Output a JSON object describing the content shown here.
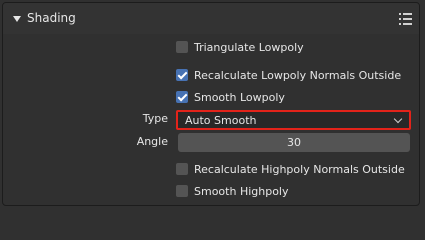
{
  "panel": {
    "title": "Shading",
    "collapse_icon": "triangle-down-icon",
    "options_icon": "list-icon"
  },
  "checkboxes": {
    "triangulate_lowpoly": {
      "label": "Triangulate Lowpoly",
      "checked": false
    },
    "recalc_lowpoly_normals": {
      "label": "Recalculate Lowpoly Normals Outside",
      "checked": true
    },
    "smooth_lowpoly": {
      "label": "Smooth Lowpoly",
      "checked": true
    },
    "recalc_highpoly_normals": {
      "label": "Recalculate Highpoly Normals Outside",
      "checked": false
    },
    "smooth_highpoly": {
      "label": "Smooth Highpoly",
      "checked": false
    }
  },
  "type_field": {
    "label": "Type",
    "value": "Auto Smooth",
    "highlight_color": "#e2231a"
  },
  "angle_field": {
    "label": "Angle",
    "value": "30"
  },
  "colors": {
    "checkbox_checked": "#4772b3",
    "checkbox_unchecked": "#545454",
    "background": "#303030"
  }
}
